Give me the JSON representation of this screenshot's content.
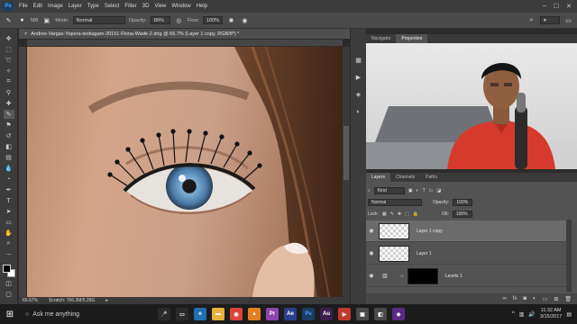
{
  "app": {
    "logo": "Ps",
    "menu": [
      "File",
      "Edit",
      "Image",
      "Layer",
      "Type",
      "Select",
      "Filter",
      "3D",
      "View",
      "Window",
      "Help"
    ]
  },
  "options": {
    "brush_size": "500",
    "mode_label": "Mode:",
    "mode_value": "Normal",
    "opacity_label": "Opacity:",
    "opacity_value": "89%",
    "flow_label": "Flow:",
    "flow_value": "100%"
  },
  "document": {
    "tab_title": "Andres-Vargas-Yopera-testiagam-20151-Fiona-Wade-2.dng @ 66.7% (Layer 1 copy, RGB/8*) *",
    "zoom": "66.67%",
    "scratch": "Scratch: 766.3M/5.28G"
  },
  "props_panel": {
    "tabs": [
      "Navigator",
      "Properties"
    ],
    "active_tab": 1
  },
  "layers_panel": {
    "tabs": [
      "Layers",
      "Channels",
      "Paths"
    ],
    "filter_kind": "Kind",
    "blend_mode": "Normal",
    "opacity_label": "Opacity:",
    "opacity_value": "100%",
    "lock_label": "Lock:",
    "fill_label": "Fill:",
    "fill_value": "100%",
    "layers": [
      {
        "name": "Layer 1 copy",
        "selected": true
      },
      {
        "name": "Layer 1",
        "selected": false
      },
      {
        "name": "Levels 1",
        "selected": false
      }
    ]
  },
  "taskbar": {
    "search_placeholder": "Ask me anything",
    "time": "11:32 AM",
    "date": "3/15/2017"
  },
  "colors": {
    "panel": "#535353",
    "dark": "#3c3c3c",
    "canvas_skin": "#d4a489",
    "iris": "#4a7aa6",
    "shirt": "#d63a2c"
  }
}
